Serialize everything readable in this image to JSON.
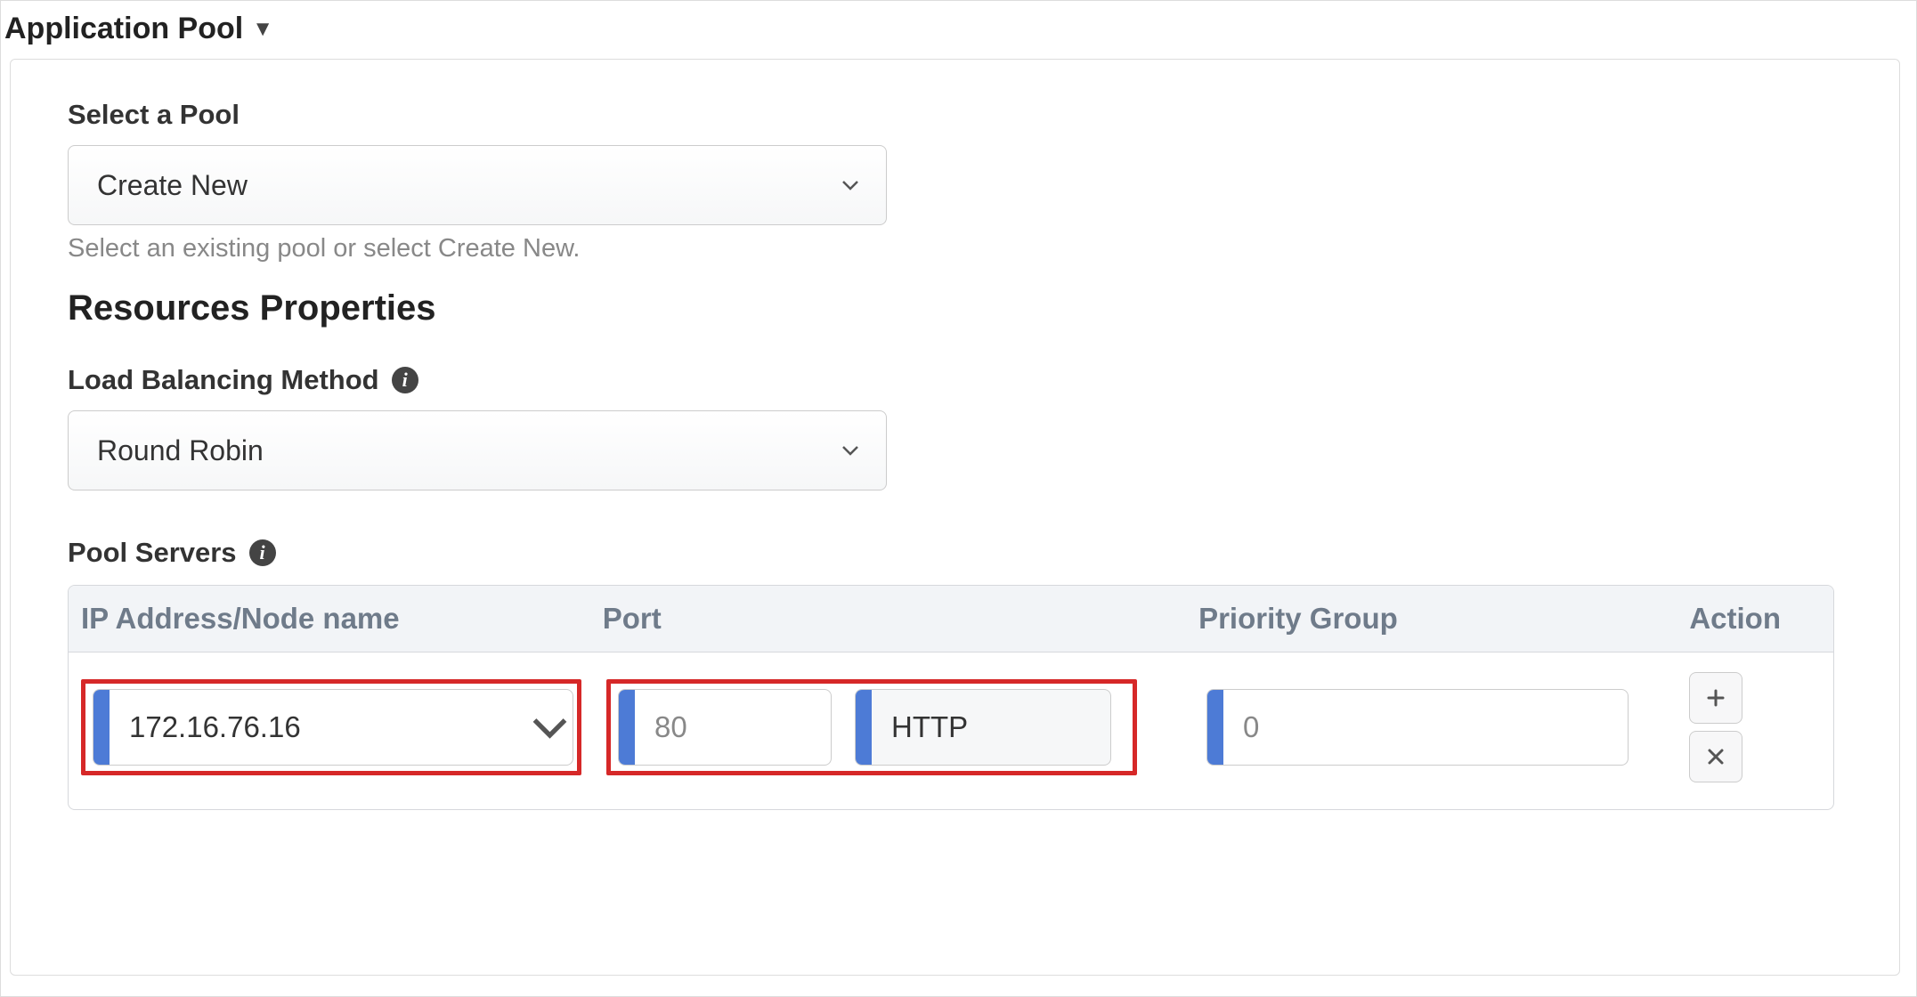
{
  "section": {
    "title": "Application Pool"
  },
  "selectPool": {
    "label": "Select a Pool",
    "value": "Create New",
    "hint": "Select an existing pool or select Create New."
  },
  "resourcesHeading": "Resources Properties",
  "loadBalancing": {
    "label": "Load Balancing Method",
    "value": "Round Robin"
  },
  "poolServers": {
    "label": "Pool Servers",
    "columns": {
      "ip": "IP Address/Node name",
      "port": "Port",
      "priority": "Priority Group",
      "action": "Action"
    },
    "row": {
      "ip": "172.16.76.16",
      "port_placeholder": "80",
      "protocol": "HTTP",
      "priority_placeholder": "0"
    }
  }
}
